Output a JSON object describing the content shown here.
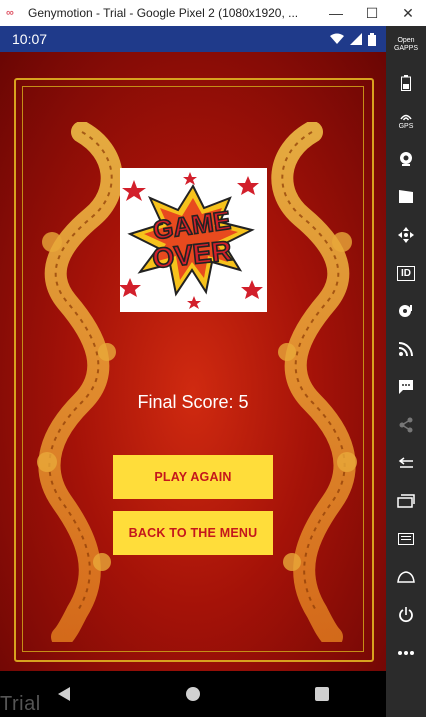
{
  "window": {
    "app_icon": "genymotion-logo-icon",
    "title": "Genymotion - Trial - Google Pixel 2 (1080x1920, ...",
    "minimize": "—",
    "maximize": "☐",
    "close": "✕"
  },
  "statusbar": {
    "time": "10:07",
    "icons": [
      "wifi-icon",
      "signal-icon",
      "battery-icon"
    ]
  },
  "game": {
    "image_alt_text": "GAME OVER",
    "final_score_label": "Final Score: 5",
    "play_again_label": "PLAY AGAIN",
    "back_to_menu_label": "BACK TO THE MENU"
  },
  "navbar": {
    "back": "back-icon",
    "home": "home-icon",
    "recents": "recents-icon"
  },
  "watermark": "Trial",
  "toolbar": {
    "opengapps_label": "Open\nGAPPS",
    "gps_label": "GPS",
    "id_label": "ID",
    "items": [
      "opengapps-icon",
      "battery-icon",
      "gps-icon",
      "camera-icon",
      "media-icon",
      "dpad-icon",
      "id-icon",
      "disk-icon",
      "rss-icon",
      "sms-icon",
      "share-icon",
      "back-icon",
      "recents-icon",
      "menu-icon",
      "home-icon",
      "power-icon",
      "more-icon"
    ]
  },
  "colors": {
    "statusbar": "#1f3a8a",
    "button_bg": "#ffdd3a",
    "button_text": "#c4161c",
    "background_red": "#a41208",
    "gold": "#d8a21f"
  }
}
